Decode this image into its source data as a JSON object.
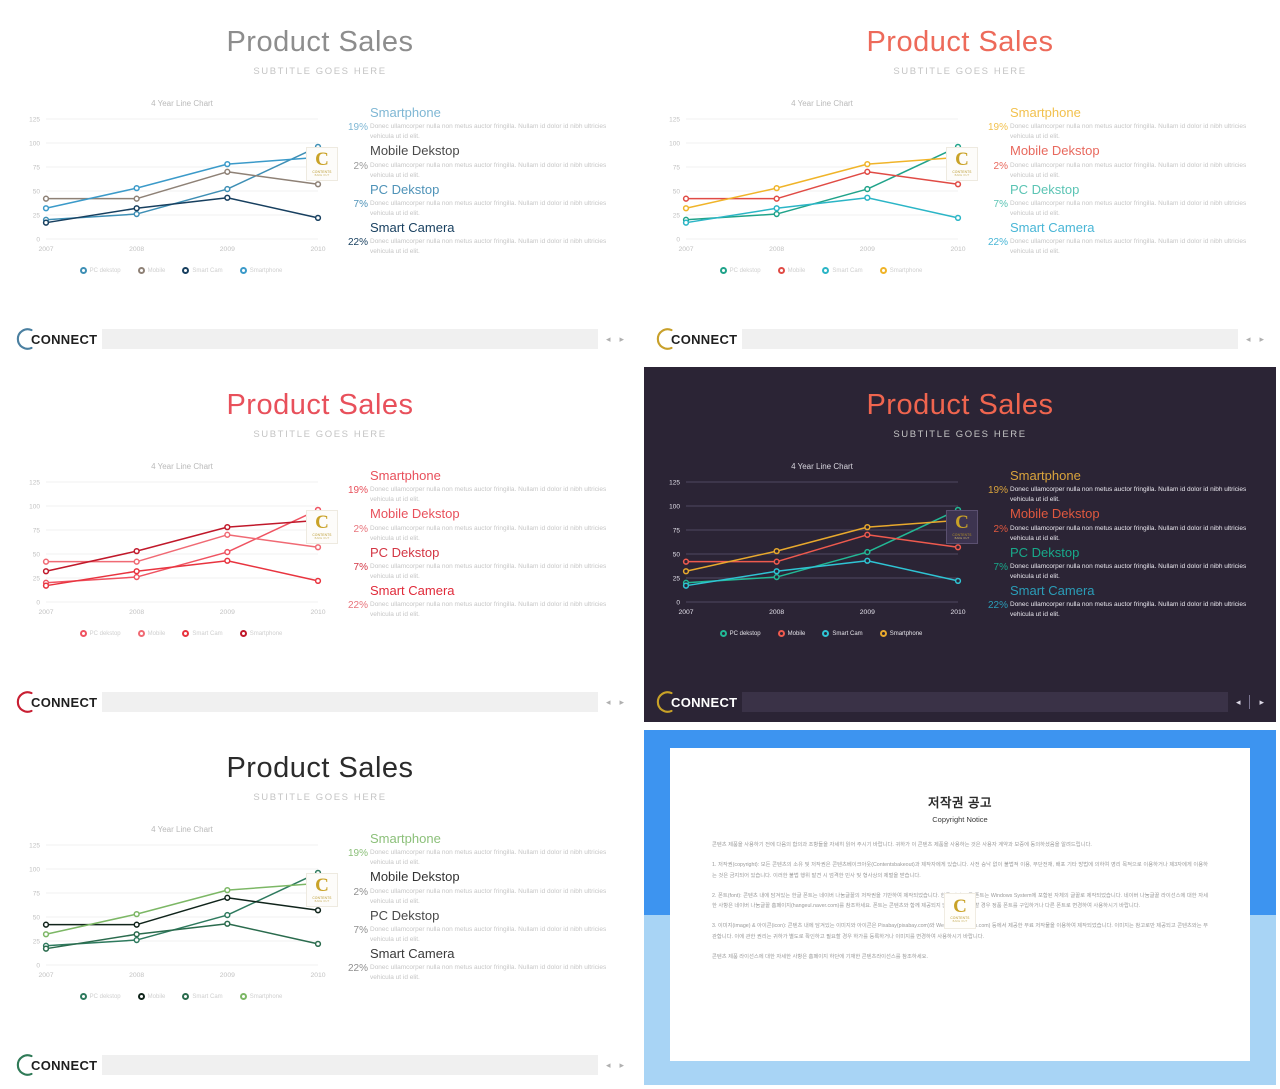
{
  "slides": [
    {
      "id": "slide-light-blue",
      "theme": "light",
      "title": "Product Sales",
      "subtitle": "SUBTITLE GOES HERE",
      "title_color": "#8d8d8d",
      "chart_title": "4 Year Line Chart",
      "colors": {
        "pc": "#3e8fb5",
        "mobile": "#8e8176",
        "smartcam": "#173f5f",
        "smartphone": "#3b9ac9"
      },
      "blocks": [
        {
          "head": "Smartphone",
          "head_color": "#7fb7d4",
          "pct": "19%",
          "pct_color": "#7fb7d4",
          "body": "Donec ullamcorper nulla non metus auctor fringilla. Nullam id dolor id nibh ultricies vehicula ut id elit."
        },
        {
          "head": "Mobile Dekstop",
          "head_color": "#4a4a4a",
          "pct": "2%",
          "pct_color": "#9a9a9a",
          "body": "Donec ullamcorper nulla non metus auctor fringilla. Nullam id dolor id nibh ultricies vehicula ut id elit."
        },
        {
          "head": "PC Dekstop",
          "head_color": "#4f93b8",
          "pct": "7%",
          "pct_color": "#4f93b8",
          "body": "Donec ullamcorper nulla non metus auctor fringilla. Nullam id dolor id nibh ultricies vehicula ut id elit."
        },
        {
          "head": "Smart Camera",
          "head_color": "#173f5f",
          "pct": "22%",
          "pct_color": "#173f5f",
          "body": "Donec ullamcorper nulla non metus auctor fringilla. Nullam id dolor id nibh ultricies vehicula ut id elit."
        }
      ],
      "footer": {
        "brand": "CONNECT",
        "logo_color": "#4a7fa0",
        "prev": "◂",
        "next": "▸"
      }
    },
    {
      "id": "slide-light-warm",
      "theme": "light",
      "title": "Product Sales",
      "subtitle": "SUBTITLE GOES HERE",
      "title_color": "#ed6a5a",
      "chart_title": "4 Year Line Chart",
      "colors": {
        "pc": "#20a38a",
        "mobile": "#e04b45",
        "smartcam": "#2bb5c6",
        "smartphone": "#f0b429"
      },
      "blocks": [
        {
          "head": "Smartphone",
          "head_color": "#f2c14e",
          "pct": "19%",
          "pct_color": "#f2c14e",
          "body": "Donec ullamcorper nulla non metus auctor fringilla. Nullam id dolor id nibh ultricies vehicula ut id elit."
        },
        {
          "head": "Mobile Dekstop",
          "head_color": "#e8695e",
          "pct": "2%",
          "pct_color": "#e8695e",
          "body": "Donec ullamcorper nulla non metus auctor fringilla. Nullam id dolor id nibh ultricies vehicula ut id elit."
        },
        {
          "head": "PC Dekstop",
          "head_color": "#5bc4b4",
          "pct": "7%",
          "pct_color": "#5bc4b4",
          "body": "Donec ullamcorper nulla non metus auctor fringilla. Nullam id dolor id nibh ultricies vehicula ut id elit."
        },
        {
          "head": "Smart Camera",
          "head_color": "#49b6d6",
          "pct": "22%",
          "pct_color": "#49b6d6",
          "body": "Donec ullamcorper nulla non metus auctor fringilla. Nullam id dolor id nibh ultricies vehicula ut id elit."
        }
      ],
      "footer": {
        "brand": "CONNECT",
        "logo_color": "#c8a02a",
        "prev": "◂",
        "next": "▸"
      }
    },
    {
      "id": "slide-light-red",
      "theme": "light",
      "title": "Product Sales",
      "subtitle": "SUBTITLE GOES HERE",
      "title_color": "#e8505b",
      "chart_title": "4 Year Line Chart",
      "colors": {
        "pc": "#ef5361",
        "mobile": "#f06a74",
        "smartcam": "#e8343f",
        "smartphone": "#c0182a"
      },
      "blocks": [
        {
          "head": "Smartphone",
          "head_color": "#e8505b",
          "pct": "19%",
          "pct_color": "#e8505b",
          "body": "Donec ullamcorper nulla non metus auctor fringilla. Nullam id dolor id nibh ultricies vehicula ut id elit."
        },
        {
          "head": "Mobile Dekstop",
          "head_color": "#e8505b",
          "pct": "2%",
          "pct_color": "#e8747c",
          "body": "Donec ullamcorper nulla non metus auctor fringilla. Nullam id dolor id nibh ultricies vehicula ut id elit."
        },
        {
          "head": "PC Dekstop",
          "head_color": "#d33644",
          "pct": "7%",
          "pct_color": "#d33644",
          "body": "Donec ullamcorper nulla non metus auctor fringilla. Nullam id dolor id nibh ultricies vehicula ut id elit."
        },
        {
          "head": "Smart Camera",
          "head_color": "#e02a3a",
          "pct": "22%",
          "pct_color": "#e8747c",
          "body": "Donec ullamcorper nulla non metus auctor fringilla. Nullam id dolor id nibh ultricies vehicula ut id elit."
        }
      ],
      "footer": {
        "brand": "CONNECT",
        "logo_color": "#c81e32",
        "prev": "◂",
        "next": "▸"
      }
    },
    {
      "id": "slide-dark",
      "theme": "dark",
      "title": "Product Sales",
      "subtitle": "SUBTITLE GOES HERE",
      "title_color": "#f0654f",
      "chart_title": "4 Year Line Chart",
      "colors": {
        "pc": "#22b895",
        "mobile": "#ef5a4e",
        "smartcam": "#2fc4d4",
        "smartphone": "#e8a92d"
      },
      "blocks": [
        {
          "head": "Smartphone",
          "head_color": "#d9a33c",
          "pct": "19%",
          "pct_color": "#d9a33c",
          "body": "Donec ullamcorper nulla non metus auctor fringilla. Nullam id dolor id nibh ultricies vehicula ut id elit."
        },
        {
          "head": "Mobile Dekstop",
          "head_color": "#e0583f",
          "pct": "2%",
          "pct_color": "#e0583f",
          "body": "Donec ullamcorper nulla non metus auctor fringilla. Nullam id dolor id nibh ultricies vehicula ut id elit."
        },
        {
          "head": "PC Dekstop",
          "head_color": "#18a98a",
          "pct": "7%",
          "pct_color": "#18a98a",
          "body": "Donec ullamcorper nulla non metus auctor fringilla. Nullam id dolor id nibh ultricies vehicula ut id elit."
        },
        {
          "head": "Smart Camera",
          "head_color": "#2b9db8",
          "pct": "22%",
          "pct_color": "#2b9db8",
          "body": "Donec ullamcorper nulla non metus auctor fringilla. Nullam id dolor id nibh ultricies vehicula ut id elit."
        }
      ],
      "footer": {
        "brand": "CONNECT",
        "logo_color": "#c9a227",
        "prev": "◂",
        "next": "▸"
      }
    },
    {
      "id": "slide-light-green",
      "theme": "light",
      "title": "Product Sales",
      "subtitle": "SUBTITLE GOES HERE",
      "title_color": "#2b2b2b",
      "chart_title": "4 Year Line Chart",
      "colors": {
        "pc": "#2e7a5e",
        "mobile": "#10241b",
        "smartcam": "#2a6b4d",
        "smartphone": "#7cb765"
      },
      "blocks": [
        {
          "head": "Smartphone",
          "head_color": "#8cc07a",
          "pct": "19%",
          "pct_color": "#8cc07a",
          "body": "Donec ullamcorper nulla non metus auctor fringilla. Nullam id dolor id nibh ultricies vehicula ut id elit."
        },
        {
          "head": "Mobile Dekstop",
          "head_color": "#333333",
          "pct": "2%",
          "pct_color": "#8f8f8f",
          "body": "Donec ullamcorper nulla non metus auctor fringilla. Nullam id dolor id nibh ultricies vehicula ut id elit."
        },
        {
          "head": "PC Dekstop",
          "head_color": "#4a4a4a",
          "pct": "7%",
          "pct_color": "#8f8f8f",
          "body": "Donec ullamcorper nulla non metus auctor fringilla. Nullam id dolor id nibh ultricies vehicula ut id elit."
        },
        {
          "head": "Smart Camera",
          "head_color": "#3a3a3a",
          "pct": "22%",
          "pct_color": "#8f8f8f",
          "body": "Donec ullamcorper nulla non metus auctor fringilla. Nullam id dolor id nibh ultricies vehicula ut id elit."
        }
      ],
      "footer": {
        "brand": "CONNECT",
        "logo_color": "#2f7a57",
        "prev": "◂",
        "next": "▸"
      }
    }
  ],
  "chart_data": {
    "type": "line",
    "title": "4 Year Line Chart",
    "xlabel": "",
    "ylabel": "",
    "x": [
      "2007",
      "2008",
      "2009",
      "2010"
    ],
    "categories": [
      "2007",
      "2008",
      "2009",
      "2010"
    ],
    "yticks": [
      0,
      25,
      50,
      75,
      100,
      125
    ],
    "ylim": [
      0,
      125
    ],
    "grid": true,
    "legend_position": "bottom",
    "series": [
      {
        "name": "PC dekstop",
        "values": [
          20,
          26,
          52,
          96
        ]
      },
      {
        "name": "Mobile",
        "values": [
          42,
          42,
          70,
          57
        ]
      },
      {
        "name": "Smart Cam",
        "values": [
          17,
          32,
          43,
          22
        ]
      },
      {
        "name": "Smartphone",
        "values": [
          32,
          53,
          78,
          85
        ]
      }
    ]
  },
  "badge": {
    "letter": "C",
    "line1": "CONTENTS",
    "line2": "BAKE OUT"
  },
  "copyright": {
    "title": "저작권 공고",
    "subtitle": "Copyright Notice",
    "paragraphs": [
      "콘텐츠 제품을 사용하기 전에 다음의 합의과 조항들을 자세히 읽어 주시기 바랍니다. 귀하가 이 콘텐츠 제품을 사용하는 것은 사용자 계약과 보증에 동의하셨음을 알려드립니다.",
      "1. 저작권(copyright): 모든 콘텐츠의 소유 및 저작권은 콘텐츠베이크아웃(Contentsbakeout)과 제작자에게 있습니다. 사전 승낙 없이 불법적 이용, 무단전재, 배포 기타 방법에 의하여 영리 목적으로 이용하거나 제3자에게 이용하는 것은 금지되어 있습니다. 이러한 불법 행위 발견 시 엄격한 민사 및 형사상의 제벌을 받습니다.",
      "2. 폰트(font): 콘텐츠 내에 담겨있는 한글 폰트는 네이버 나눔글꼴의 저작권을 기반하여 제작되었습니다. 한글 외의 모든 폰트는 Windows System에 포함된 자체의 글꼴로 제작되었습니다. 네이버 나눔글꼴 라이선스에 대한 자세한 사항은 네이버 나눔글꼴 홈페이지(hangeul.naver.com)를 참조하세요. 폰트는 콘텐츠와 함께 제공되지 않으므로, 필요할 경우 정품 폰트를 구입하거나 다른 폰트로 변경하여 사용하시기 바랍니다.",
      "3. 이미지(image) & 아이콘(icon): 콘텐츠 내에 담겨있는 이미지와 아이콘은 Pixabay(pixabay.com)와 Webalys(webalys.com) 등에서 제공한 무료 저작물을 이용하여 제작되었습니다. 이미지는 참고로만 제공되고 콘텐츠와는 무관합니다. 이에 관한 권리는 귀하가 별도로 확인하고 필요할 경우 하가를 등록하거나 이미지를 변경하여 사용하시기 바랍니다.",
      "콘텐츠 제품 라이선스에 대한 자세한 사항은 홈페이지 하단에 기재한 콘텐츠라이선스를 참조하세요."
    ]
  }
}
